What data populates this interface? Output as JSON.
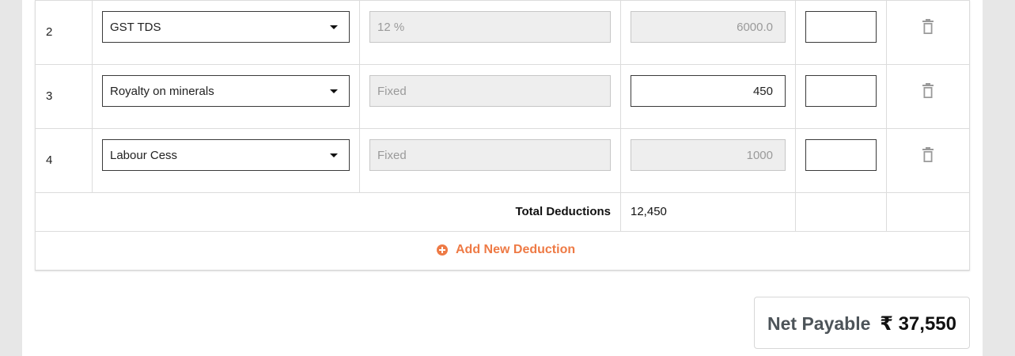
{
  "deductions": {
    "rows": [
      {
        "sn": "2",
        "type": "GST TDS",
        "rate": "12 %",
        "amount": "6000.0",
        "amount_editable": false,
        "reference": ""
      },
      {
        "sn": "3",
        "type": "Royalty on minerals",
        "rate": "Fixed",
        "amount": "450",
        "amount_editable": true,
        "reference": ""
      },
      {
        "sn": "4",
        "type": "Labour Cess",
        "rate": "Fixed",
        "amount": "1000",
        "amount_editable": false,
        "reference": ""
      }
    ],
    "total_label": "Total Deductions",
    "total_value": "12,450",
    "add_label": "Add New Deduction"
  },
  "net_payable": {
    "label": "Net Payable",
    "value": "₹ 37,550"
  },
  "colors": {
    "accent": "#ee7a45",
    "background": "#e7e7e7",
    "disabled_field": "#eeeeee"
  },
  "icons": {
    "row_delete": "trash-icon",
    "add": "plus-circle-icon",
    "select": "chevron-down-icon"
  }
}
